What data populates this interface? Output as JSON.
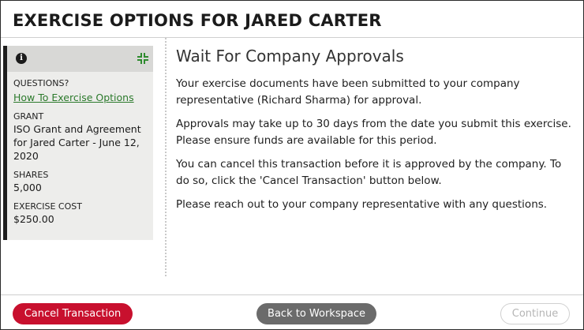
{
  "header": {
    "title": "EXERCISE OPTIONS FOR JARED CARTER"
  },
  "sidebar": {
    "info_icon": "info-icon",
    "collapse_icon": "collapse-icon",
    "questions_label": "QUESTIONS?",
    "questions_link": "How To Exercise Options",
    "grant_label": "GRANT",
    "grant_value": "ISO Grant and Agreement for Jared Carter - June 12, 2020",
    "shares_label": "SHARES",
    "shares_value": "5,000",
    "cost_label": "EXERCISE COST",
    "cost_value": "$250.00"
  },
  "main": {
    "heading": "Wait For Company Approvals",
    "paragraphs": [
      "Your exercise documents have been submitted to your company representative (Richard Sharma) for approval.",
      "Approvals may take up to 30 days from the date you submit this exercise. Please ensure funds are available for this period.",
      "You can cancel this transaction before it is approved by the company. To do so, click the 'Cancel Transaction' button below.",
      "Please reach out to your company representative with any questions."
    ]
  },
  "footer": {
    "cancel_label": "Cancel Transaction",
    "back_label": "Back to Workspace",
    "continue_label": "Continue"
  },
  "colors": {
    "cancel": "#c8102e",
    "back": "#6b6b6b",
    "link": "#2c7a2c",
    "collapse_icon": "#2e8b2e"
  }
}
